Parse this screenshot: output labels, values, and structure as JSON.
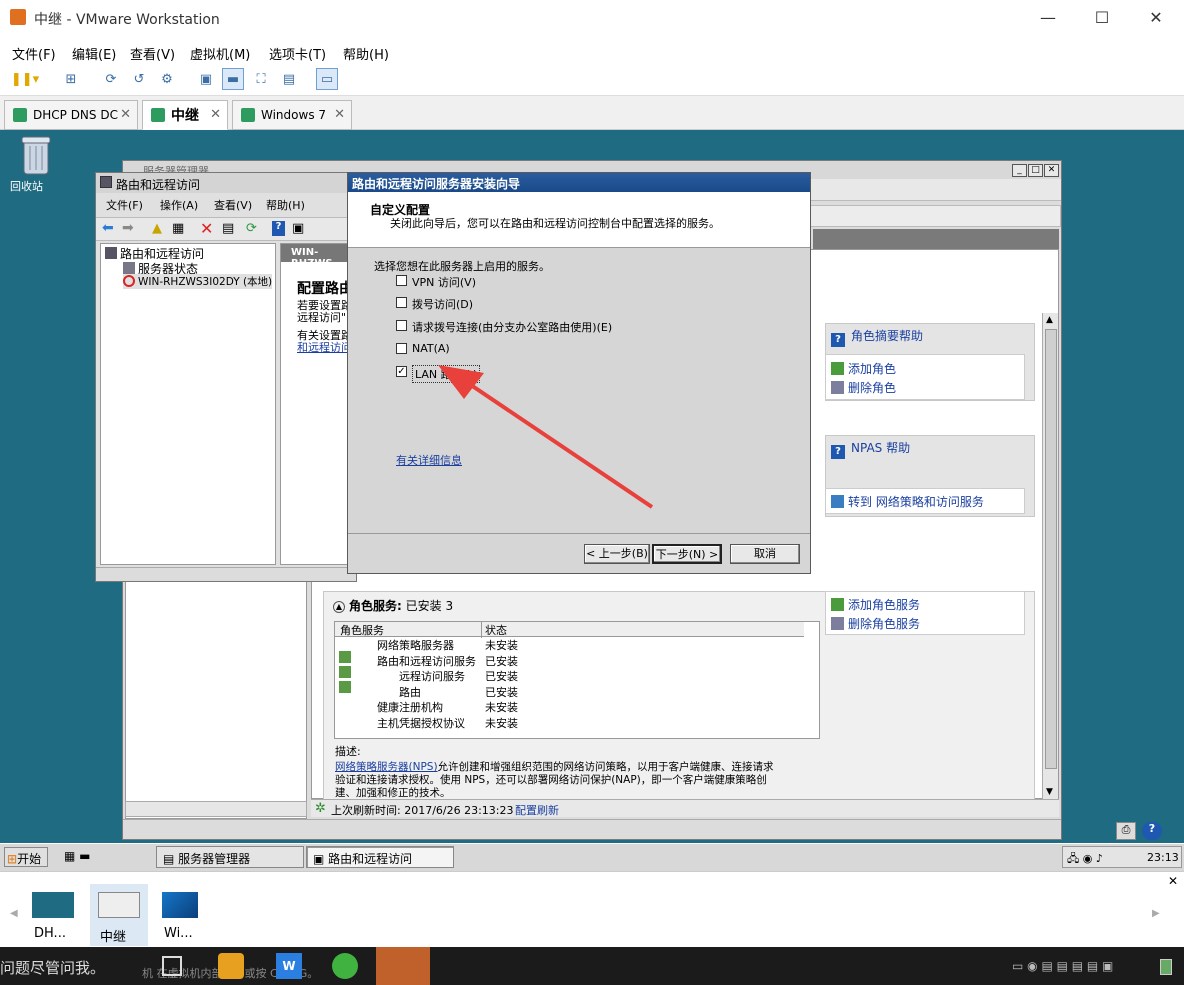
{
  "window": {
    "title": "中继 - VMware Workstation",
    "controls": [
      "—",
      "☐",
      "✕"
    ]
  },
  "menu": [
    "文件(F)",
    "编辑(E)",
    "查看(V)",
    "虚拟机(M)",
    "选项卡(T)",
    "帮助(H)"
  ],
  "tabs": [
    {
      "label": "DHCP DNS DC",
      "close": "✕"
    },
    {
      "label": "中继",
      "close": "✕"
    },
    {
      "label": "Windows 7",
      "close": "✕"
    }
  ],
  "desktop": {
    "recycle": "回收站"
  },
  "server_manager": {
    "title": "服务器管理器",
    "role_summary_help": "角色摘要帮助",
    "add_role": "添加角色",
    "remove_role": "删除角色",
    "npas_help": "NPAS 帮助",
    "goto_npas": "转到 网络策略和访问服务",
    "role_services_header": "角色服务:",
    "role_services_status": "已安装 3",
    "add_role_service": "添加角色服务",
    "remove_role_service": "删除角色服务",
    "table_headers": [
      "角色服务",
      "状态"
    ],
    "table_rows": [
      [
        "网络策略服务器",
        "未安装"
      ],
      [
        "路由和远程访问服务",
        "已安装"
      ],
      [
        "远程访问服务",
        "已安装"
      ],
      [
        "路由",
        "已安装"
      ],
      [
        "健康注册机构",
        "未安装"
      ],
      [
        "主机凭据授权协议",
        "未安装"
      ]
    ],
    "desc_label": "描述:",
    "desc_link": "网络策略服务器(NPS)",
    "desc_text1": "允许创建和增强组织范围的网络访问策略，以用于客户端健康、连接请求",
    "desc_text2": "验证和连接请求授权。使用 NPS，还可以部署网络访问保护(NAP)，即一个客户端健康策略创",
    "desc_text3": "建、加强和修正的技术。",
    "refresh_text": "上次刷新时间: 2017/6/26 23:13:23",
    "refresh_link": "配置刷新"
  },
  "rras": {
    "title": "路由和远程访问",
    "menu": [
      "文件(F)",
      "操作(A)",
      "查看(V)",
      "帮助(H)"
    ],
    "tree": [
      "路由和远程访问",
      "服务器状态",
      "WIN-RHZWS3I02DY (本地)"
    ],
    "right_header": "WIN-RHZWS",
    "right_title": "配置路由",
    "right_l1": "若要设置路",
    "right_l2": "远程访问\"",
    "right_l3": "有关设置路",
    "right_l4": "和远程访问"
  },
  "wizard": {
    "title": "路由和远程访问服务器安装向导",
    "heading": "自定义配置",
    "subheading": "关闭此向导后，您可以在路由和远程访问控制台中配置选择的服务。",
    "prompt": "选择您想在此服务器上启用的服务。",
    "options": [
      {
        "label": "VPN 访问(V)",
        "checked": false
      },
      {
        "label": "拨号访问(D)",
        "checked": false
      },
      {
        "label": "请求拨号连接(由分支办公室路由使用)(E)",
        "checked": false
      },
      {
        "label": "NAT(A)",
        "checked": false
      },
      {
        "label": "LAN 路由(L)",
        "checked": true
      }
    ],
    "more_info": "有关详细信息",
    "back": "< 上一步(B)",
    "next": "下一步(N) >",
    "cancel": "取消"
  },
  "vm_taskbar": {
    "start": "开始",
    "items": [
      "服务器管理器",
      "路由和远程访问"
    ],
    "clock": "23:13"
  },
  "thumbnails": [
    {
      "label": "DH..."
    },
    {
      "label": "中继"
    },
    {
      "label": "Wi..."
    }
  ],
  "host_taskbar": {
    "left_text": "问题尽管问我。",
    "mid_text": "机   在虚拟机内部单击或按 Ctrl+G。"
  }
}
